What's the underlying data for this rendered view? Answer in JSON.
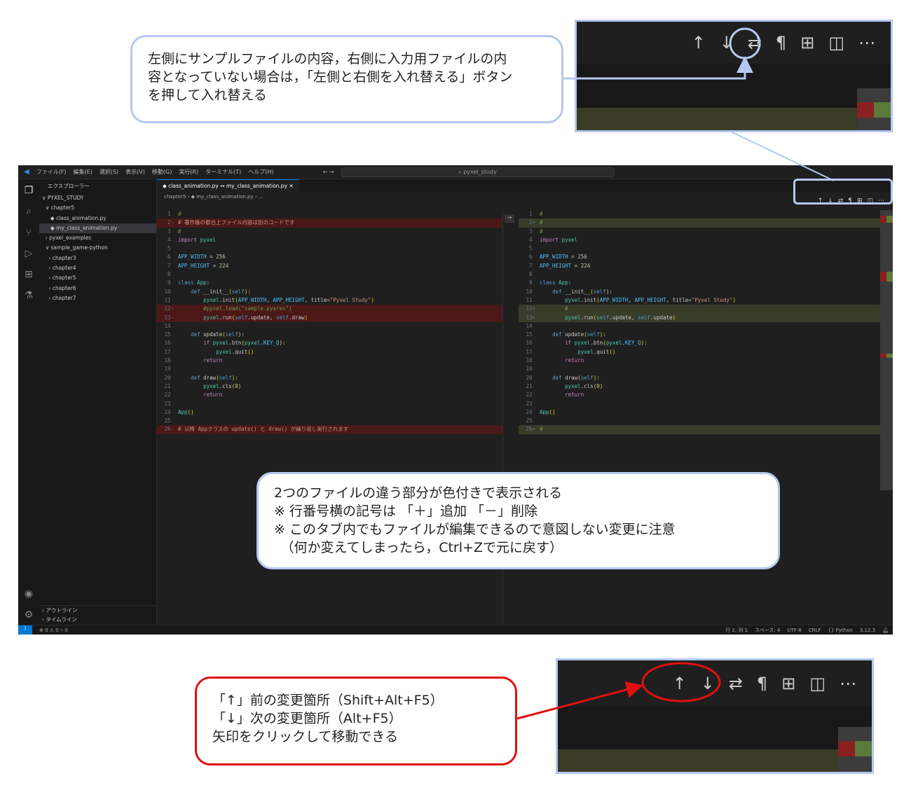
{
  "callouts": {
    "swap": [
      "左側にサンプルファイルの内容，右側に入力用ファイルの内",
      "容となっていない場合は，「左側と右側を入れ替える」ボタン",
      "を押して入れ替える"
    ],
    "diff": [
      "2つのファイルの違う部分が色付きで表示される",
      "※ 行番号横の記号は 「＋」追加 「－」削除",
      "※ このタブ内でもファイルが編集できるので意図しない変更に注意",
      "　（何か変えてしまったら，Ctrl+Zで元に戻す）"
    ],
    "nav": [
      "「↑」前の変更箇所（Shift+Alt+F5）",
      "「↓」次の変更箇所（Alt+F5）",
      "矢印をクリックして移動できる"
    ]
  },
  "toolbar_icons": {
    "prev": "↑",
    "next": "↓",
    "swap": "⇄",
    "whitespace": "¶",
    "minimap": "⊞",
    "split": "◫",
    "more": "⋯"
  },
  "colors": {
    "callout_border": "#b4c8f0",
    "callout_red": "#e01010",
    "deleted": "#4b1818",
    "added": "#373d29"
  },
  "vscode": {
    "menu": [
      "ファイル(F)",
      "編集(E)",
      "選択(S)",
      "表示(V)",
      "移動(G)",
      "実行(R)",
      "ターミナル(T)",
      "ヘルプ(H)"
    ],
    "search": "pyxel_study",
    "explorer_title": "エクスプローラー",
    "tree": [
      "∨ PYXEL_STUDY",
      "  ∨ chapter5",
      "     ◆ class_animation.py",
      "     ◆ my_class_animation.py",
      "  › pyxel_examples",
      "  ∨ sample_game-python",
      "    › chapter3",
      "    › chapter4",
      "    › chapter5",
      "    › chapter6",
      "    › chapter7"
    ],
    "outline": "› アウトライン",
    "timeline": "› タイムライン",
    "tab": "◆ class_animation.py ↔ my_class_animation.py  ✕",
    "breadcrumb": "chapter5 › ◆ my_class_animation.py › ...",
    "left": [
      [
        "1",
        " ",
        "#"
      ],
      [
        "2",
        "-",
        "# 著作権の都合上ファイル内容は別のコードです"
      ],
      [
        "3",
        " ",
        "#"
      ],
      [
        "4",
        " ",
        "import pyxel"
      ],
      [
        "5",
        " ",
        ""
      ],
      [
        "6",
        " ",
        "APP_WIDTH = 256"
      ],
      [
        "7",
        " ",
        "APP_HEIGHT = 224"
      ],
      [
        "8",
        " ",
        ""
      ],
      [
        "9",
        " ",
        "class App:"
      ],
      [
        "10",
        " ",
        "    def __init__(self):"
      ],
      [
        "11",
        " ",
        "        pyxel.init(APP_WIDTH, APP_HEIGHT, title=\"Pyxel Study\")"
      ],
      [
        "12",
        "-",
        "        #pyxel.load(\"sample.pyxres\")"
      ],
      [
        "13",
        "-",
        "        pyxel.run(self.update, self.draw)"
      ],
      [
        "14",
        " ",
        ""
      ],
      [
        "15",
        " ",
        "    def update(self):"
      ],
      [
        "16",
        " ",
        "        if pyxel.btn(pyxel.KEY_Q):"
      ],
      [
        "17",
        " ",
        "            pyxel.quit()"
      ],
      [
        "18",
        " ",
        "        return"
      ],
      [
        "19",
        " ",
        ""
      ],
      [
        "20",
        " ",
        "    def draw(self):"
      ],
      [
        "21",
        " ",
        "        pyxel.cls(0)"
      ],
      [
        "22",
        " ",
        "        return"
      ],
      [
        "23",
        " ",
        ""
      ],
      [
        "24",
        " ",
        "App()"
      ],
      [
        "25",
        " ",
        ""
      ],
      [
        "26",
        "-",
        "# 以降 Appクラスの update() と draw() が繰り返し実行されます"
      ]
    ],
    "right": [
      [
        "1",
        " ",
        "#"
      ],
      [
        "2",
        "+",
        "#"
      ],
      [
        "3",
        " ",
        "#"
      ],
      [
        "4",
        " ",
        "import pyxel"
      ],
      [
        "5",
        " ",
        ""
      ],
      [
        "6",
        " ",
        "APP_WIDTH = 256"
      ],
      [
        "7",
        " ",
        "APP_HEIGHT = 224"
      ],
      [
        "8",
        " ",
        ""
      ],
      [
        "9",
        " ",
        "class App:"
      ],
      [
        "10",
        " ",
        "    def __init__(self):"
      ],
      [
        "11",
        " ",
        "        pyxel.init(APP_WIDTH, APP_HEIGHT, title=\"Pyxel Study\")"
      ],
      [
        "12",
        "+",
        "        #"
      ],
      [
        "13",
        "+",
        "        pyxel.run(self.update, self.update)"
      ],
      [
        "14",
        " ",
        ""
      ],
      [
        "15",
        " ",
        "    def update(self):"
      ],
      [
        "16",
        " ",
        "        if pyxel.btn(pyxel.KEY_Q):"
      ],
      [
        "17",
        " ",
        "            pyxel.quit()"
      ],
      [
        "18",
        " ",
        "        return"
      ],
      [
        "19",
        " ",
        ""
      ],
      [
        "20",
        " ",
        "    def draw(self):"
      ],
      [
        "21",
        " ",
        "        pyxel.cls(0)"
      ],
      [
        "22",
        " ",
        "        return"
      ],
      [
        "23",
        " ",
        ""
      ],
      [
        "24",
        " ",
        "App()"
      ],
      [
        "25",
        " ",
        ""
      ],
      [
        "26",
        "+",
        "#"
      ]
    ],
    "status": {
      "left": "⊗ 0 ⚠ 0   ⑂ 0",
      "pos": "行 2, 列 1",
      "spaces": "スペース: 4",
      "enc": "UTF-8",
      "eol": "CRLF",
      "lang": "{} Python",
      "ver": "3.12.3"
    }
  }
}
